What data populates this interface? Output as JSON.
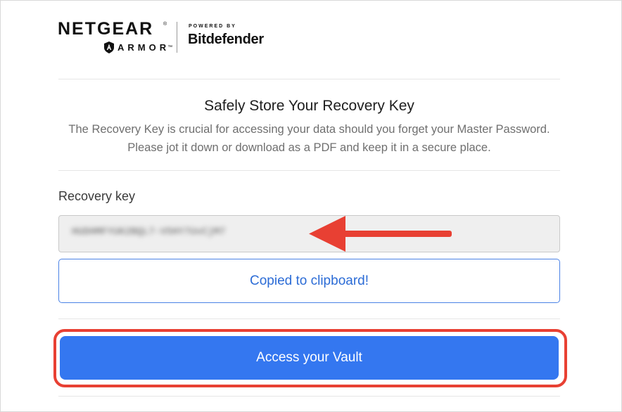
{
  "brand": {
    "netgear": "NETGEAR",
    "tm": "®",
    "armor": "ARMOR",
    "armor_tm": "™",
    "powered_by": "POWERED BY",
    "bitdefender": "Bitdefender"
  },
  "header": {
    "title": "Safely Store Your Recovery Key",
    "description": "The Recovery Key is crucial for accessing your data should you forget your Master Password. Please jot it down or download as a PDF and keep it in a secure place."
  },
  "recovery": {
    "label": "Recovery key",
    "value": "HUDHMFYUK2BQL7-V5HY7UvCjM7",
    "copied_label": "Copied to clipboard!"
  },
  "actions": {
    "access_label": "Access your Vault"
  },
  "colors": {
    "accent": "#3477f0",
    "link": "#2c6cd6",
    "annotation": "#e84033"
  },
  "icons": {
    "shield": "armor-shield-icon",
    "arrow": "red-arrow-annotation"
  }
}
